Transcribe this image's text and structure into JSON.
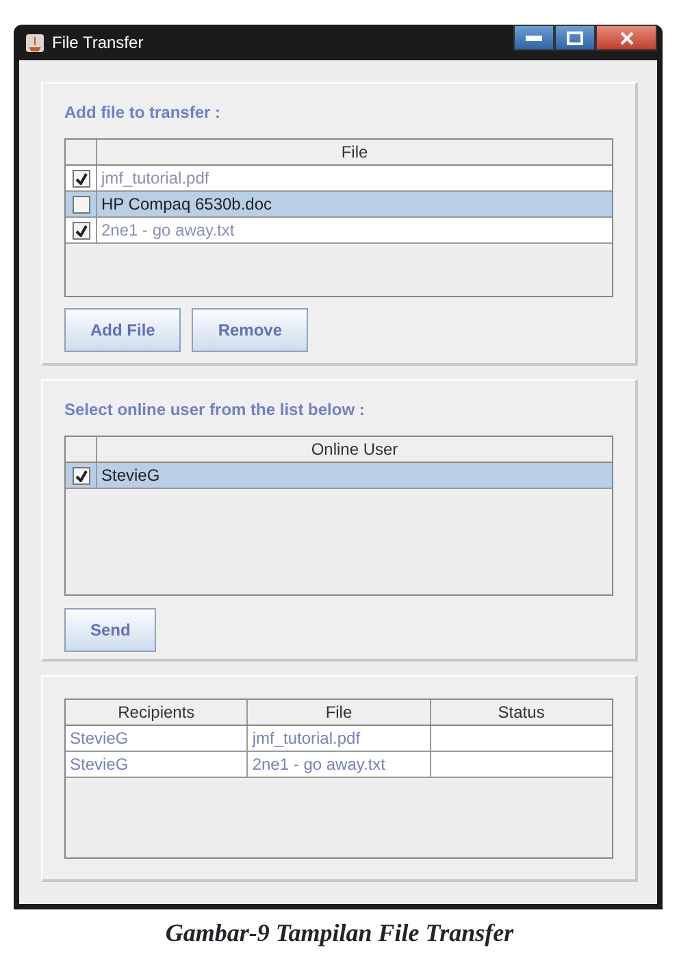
{
  "window": {
    "title": "File Transfer"
  },
  "file_section": {
    "label": "Add file to transfer :",
    "columns": [
      "File"
    ],
    "rows": [
      {
        "name": "jmf_tutorial.pdf",
        "checked": true,
        "selected": false
      },
      {
        "name": "HP Compaq 6530b.doc",
        "checked": false,
        "selected": true
      },
      {
        "name": "2ne1 - go away.txt",
        "checked": true,
        "selected": false
      }
    ],
    "buttons": [
      "Add File",
      "Remove"
    ]
  },
  "user_section": {
    "label": "Select online user from the list below :",
    "columns": [
      "Online User"
    ],
    "rows": [
      {
        "name": "StevieG",
        "checked": true,
        "selected": true
      }
    ],
    "buttons": [
      "Send"
    ]
  },
  "transfer_table": {
    "columns": [
      "Recipients",
      "File",
      "Status"
    ],
    "rows": [
      [
        "StevieG",
        "jmf_tutorial.pdf"
      ],
      [
        "StevieG",
        "2ne1 - go away.txt"
      ]
    ]
  },
  "caption": "Gambar-9 Tampilan File Transfer"
}
